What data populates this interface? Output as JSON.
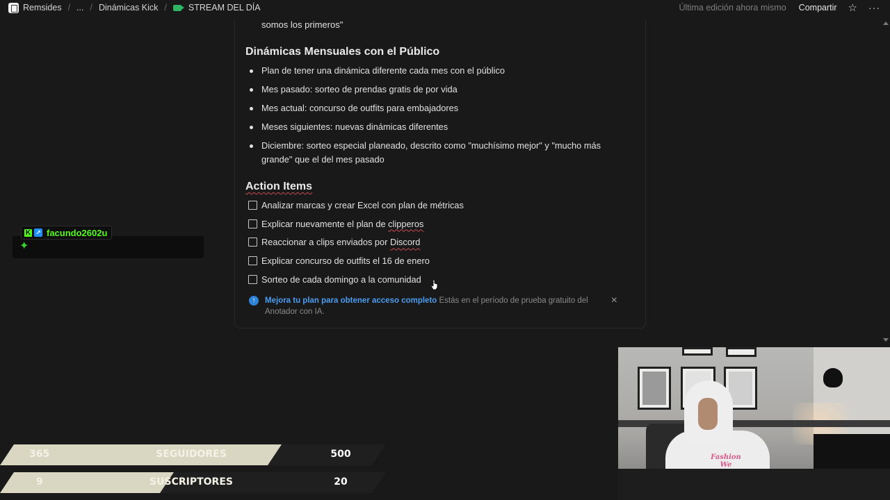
{
  "topbar": {
    "workspace": "Remsides",
    "ellipsis": "...",
    "parent_page": "Dinámicas Kick",
    "current_page": "STREAM DEL DÍA",
    "last_edit": "Última edición ahora mismo",
    "share": "Compartir",
    "more": "···"
  },
  "doc": {
    "prev_text": "somos los primeros\"",
    "section_title": "Dinámicas Mensuales con el Público",
    "bullets": [
      "Plan de tener una dinámica diferente cada mes con el público",
      "Mes pasado: sorteo de prendas gratis de por vida",
      "Mes actual: concurso de outfits para embajadores",
      "Meses siguientes: nuevas dinámicas diferentes",
      "Diciembre: sorteo especial planeado, descrito como \"muchísimo mejor\" y \"mucho más grande\" que el del mes pasado"
    ],
    "action_title": "Action Items",
    "todos": [
      "Analizar marcas y crear Excel con plan de métricas",
      "Explicar nuevamente el plan de ",
      "Reaccionar a clips enviados por ",
      "Explicar concurso de outfits el 16 de enero",
      "Sorteo de cada domingo a la comunidad"
    ],
    "todo_squig_1": "clipperos",
    "todo_squig_2": "Discord",
    "upgrade_link": "Mejora tu plan para obtener acceso completo",
    "upgrade_text": " Estás en el período de prueba gratuito del Anotador con IA.",
    "close": "×"
  },
  "chat": {
    "username": "facundo2602u",
    "kick_badge": "K",
    "emote": "✦"
  },
  "stats": [
    {
      "current": "365",
      "label": "SEGUIDORES",
      "goal": "500",
      "progress": 0.73
    },
    {
      "current": "9",
      "label": "SUSCRIPTORES",
      "goal": "20",
      "progress": 0.45
    }
  ],
  "webcam": {
    "shirt_print": "Fashion We"
  },
  "colors": {
    "background": "#191919",
    "link": "#4a9cf0",
    "kick_green": "#53fc18",
    "stat_fill": "#d9d6c2"
  }
}
